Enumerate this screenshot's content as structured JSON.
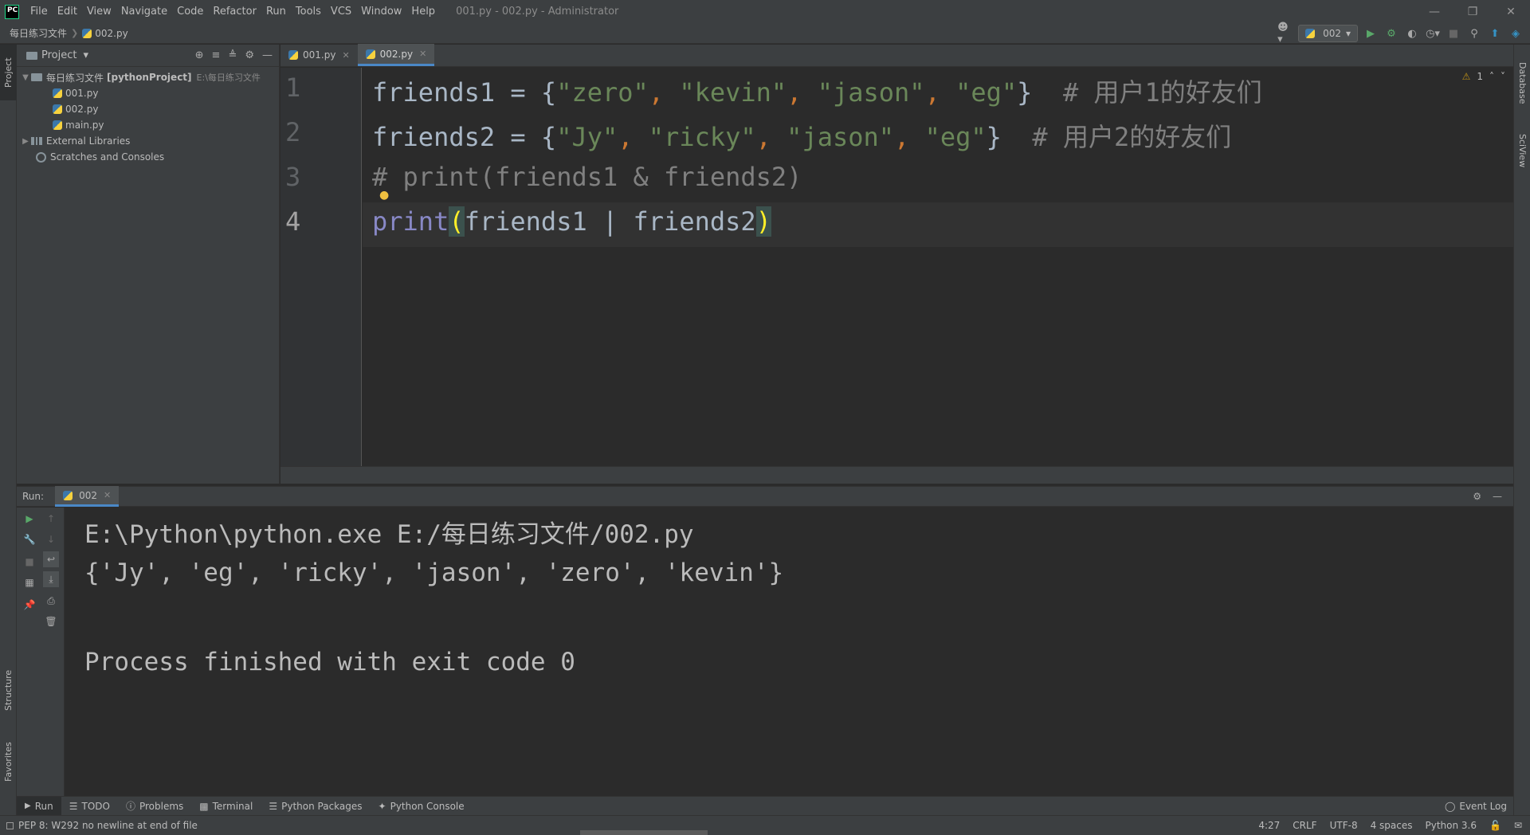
{
  "titlebar": {
    "logo": "PC",
    "menus": [
      "File",
      "Edit",
      "View",
      "Navigate",
      "Code",
      "Refactor",
      "Run",
      "Tools",
      "VCS",
      "Window",
      "Help"
    ],
    "window_title": "001.py - 002.py - Administrator",
    "controls": [
      "minimize",
      "restore",
      "close"
    ]
  },
  "navbar": {
    "breadcrumb": [
      "每日练习文件",
      "002.py"
    ],
    "run_config": "002"
  },
  "project_panel": {
    "title": "Project",
    "tree": {
      "root_name": "每日练习文件",
      "root_project": "[pythonProject]",
      "root_path": "E:\\每日练习文件",
      "files": [
        "001.py",
        "002.py",
        "main.py"
      ],
      "external_libraries": "External Libraries",
      "scratches": "Scratches and Consoles"
    }
  },
  "left_stripe": {
    "project": "Project",
    "structure": "Structure",
    "favorites": "Favorites"
  },
  "right_stripe": {
    "database": "Database",
    "sciview": "SciView"
  },
  "editor": {
    "tabs": [
      {
        "label": "001.py",
        "active": false
      },
      {
        "label": "002.py",
        "active": true
      }
    ],
    "inspection_count": "1",
    "line_numbers": [
      "1",
      "2",
      "3",
      "4"
    ],
    "lines": {
      "l1": {
        "var": "friends1 = {",
        "s1": "\"zero\"",
        "p1": ", ",
        "s2": "\"kevin\"",
        "p2": ", ",
        "s3": "\"jason\"",
        "p3": ", ",
        "s4": "\"eg\"",
        "close": "}  ",
        "comment": "# 用户1的好友们"
      },
      "l2": {
        "var": "friends2 = {",
        "s1": "\"Jy\"",
        "p1": ", ",
        "s2": "\"ricky\"",
        "p2": ", ",
        "s3": "\"jason\"",
        "p3": ", ",
        "s4": "\"eg\"",
        "close": "}  ",
        "comment": "# 用户2的好友们"
      },
      "l3": {
        "comment": "# print(friends1 & friends2)"
      },
      "l4": {
        "fn": "print",
        "open": "(",
        "body": "friends1 | friends2",
        "close": ")"
      }
    }
  },
  "run_panel": {
    "label": "Run:",
    "tab": "002",
    "output": [
      "E:\\Python\\python.exe E:/每日练习文件/002.py",
      "{'Jy', 'eg', 'ricky', 'jason', 'zero', 'kevin'}",
      "",
      "Process finished with exit code 0"
    ]
  },
  "bottom_tabs": [
    "Run",
    "TODO",
    "Problems",
    "Terminal",
    "Python Packages",
    "Python Console"
  ],
  "event_log": "Event Log",
  "statusbar": {
    "message": "PEP 8: W292 no newline at end of file",
    "position": "4:27",
    "line_sep": "CRLF",
    "encoding": "UTF-8",
    "indent": "4 spaces",
    "interpreter": "Python 3.6"
  },
  "colors": {
    "background": "#2b2b2b",
    "panel": "#3c3f41",
    "string": "#6a8759",
    "keyword_punc": "#cc7832",
    "comment": "#808080",
    "builtin": "#8888c6",
    "text": "#a9b7c6",
    "accent": "#4a88c7"
  }
}
